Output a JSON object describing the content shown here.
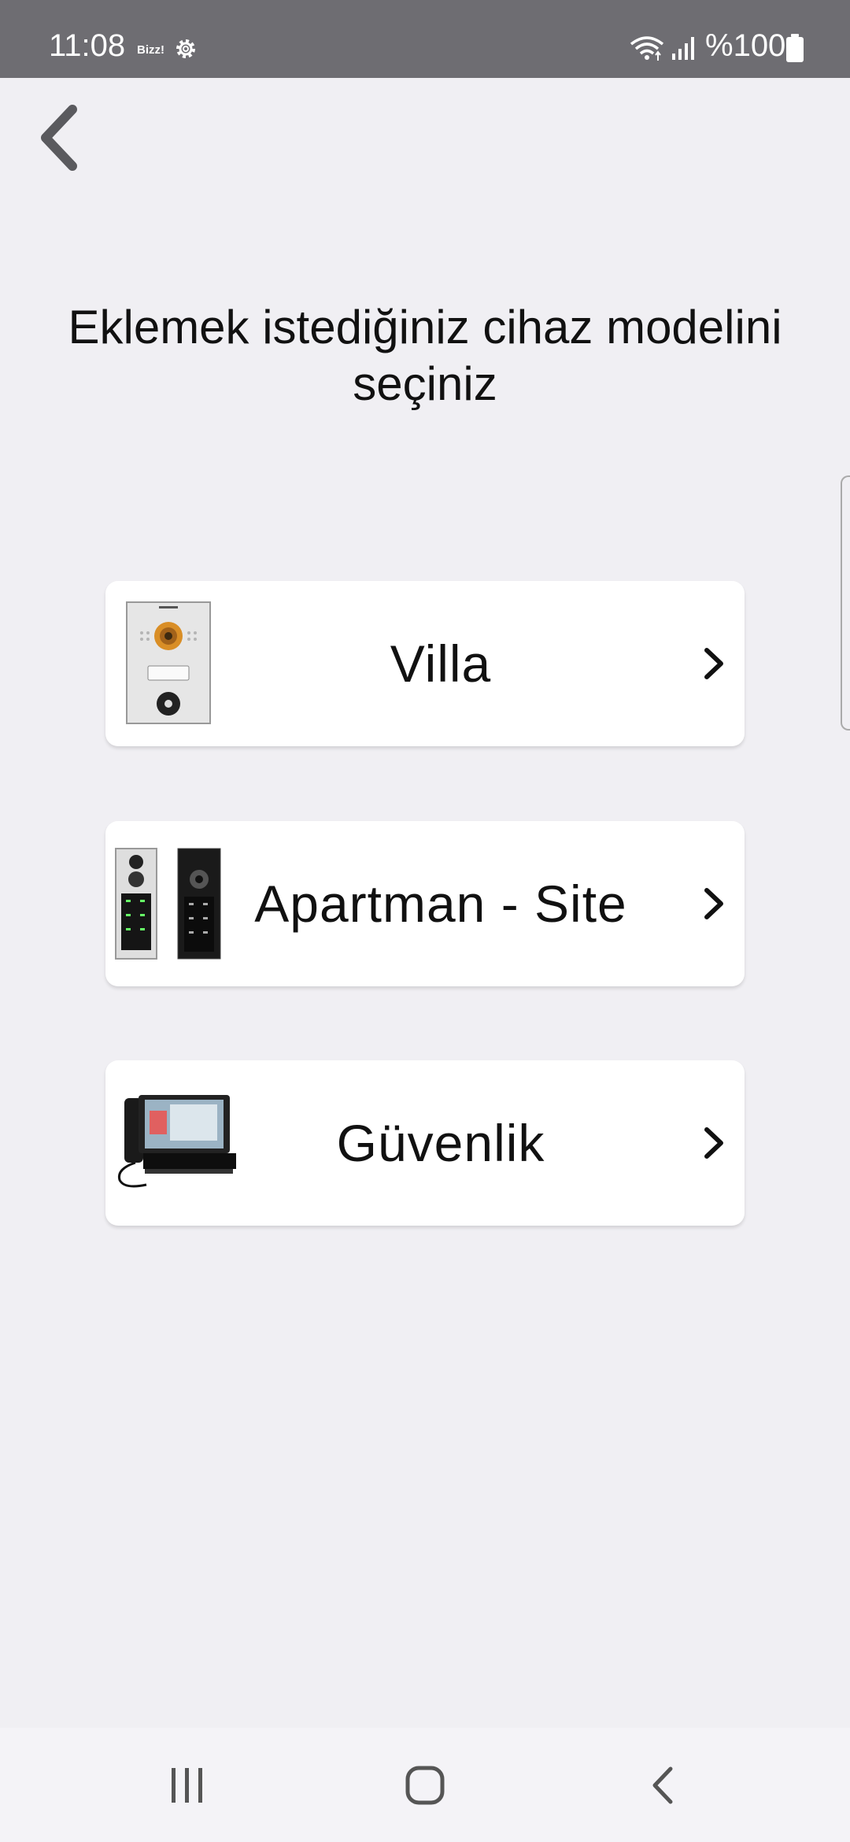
{
  "status_bar": {
    "time": "11:08",
    "notification_app": "Bizz!",
    "battery": "%100",
    "icons": [
      "settings-gear-icon",
      "wifi-icon",
      "signal-icon",
      "battery-icon"
    ]
  },
  "header": {
    "back_icon": "chevron-left-icon"
  },
  "title": "Eklemek istediğiniz cihaz modelini seçiniz",
  "options": [
    {
      "label": "Villa",
      "image": "villa-door-panel-image"
    },
    {
      "label": "Apartman - Site",
      "image": "apartment-door-panels-image"
    },
    {
      "label": "Güvenlik",
      "image": "security-console-image"
    }
  ],
  "nav_bar": {
    "icons": [
      "recent-apps-icon",
      "home-icon",
      "back-icon"
    ]
  },
  "colors": {
    "background": "#f0eff3",
    "status_bar": "#6e6d72",
    "card": "#ffffff",
    "text": "#111111"
  }
}
